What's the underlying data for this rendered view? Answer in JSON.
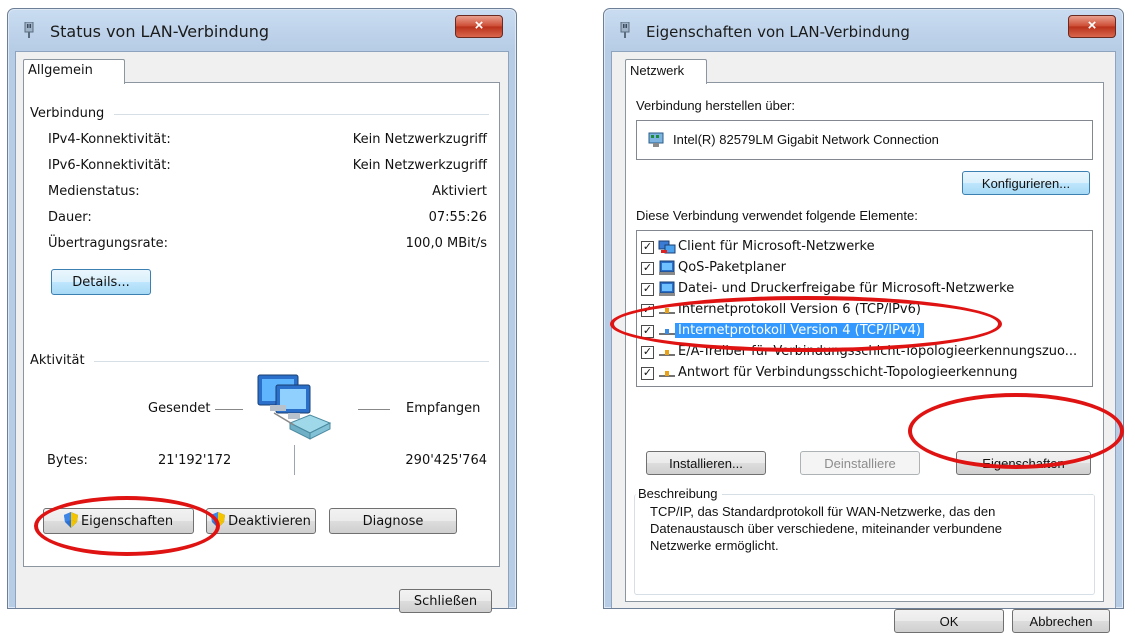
{
  "status_window": {
    "title": "Status von LAN-Verbindung",
    "close_label": "×",
    "tab": "Allgemein",
    "connection_group": "Verbindung",
    "rows": [
      {
        "label": "IPv4-Konnektivität:",
        "value": "Kein Netzwerkzugriff"
      },
      {
        "label": "IPv6-Konnektivität:",
        "value": "Kein Netzwerkzugriff"
      },
      {
        "label": "Medienstatus:",
        "value": "Aktiviert"
      },
      {
        "label": "Dauer:",
        "value": "07:55:26"
      },
      {
        "label": "Übertragungsrate:",
        "value": "100,0 MBit/s"
      }
    ],
    "details_button": "Details...",
    "activity_group": "Aktivität",
    "sent_label": "Gesendet",
    "received_label": "Empfangen",
    "bytes_label": "Bytes:",
    "bytes_sent": "21'192'172",
    "bytes_received": "290'425'764",
    "properties_button": "Eigenschaften",
    "disable_button": "Deaktivieren",
    "diagnose_button": "Diagnose",
    "close_button": "Schließen"
  },
  "properties_window": {
    "title": "Eigenschaften von LAN-Verbindung",
    "close_label": "×",
    "tab": "Netzwerk",
    "connect_using_label": "Verbindung herstellen über:",
    "adapter_name": "Intel(R) 82579LM Gigabit Network Connection",
    "configure_button": "Konfigurieren...",
    "items_label": "Diese Verbindung verwendet folgende Elemente:",
    "items": [
      {
        "label": "Client für Microsoft-Netzwerke",
        "checked": true,
        "icon": "network-client-icon"
      },
      {
        "label": "QoS-Paketplaner",
        "checked": true,
        "icon": "network-service-icon"
      },
      {
        "label": "Datei- und Druckerfreigabe für Microsoft-Netzwerke",
        "checked": true,
        "icon": "network-service-icon"
      },
      {
        "label": "Internetprotokoll Version 6 (TCP/IPv6)",
        "checked": true,
        "icon": "protocol-icon"
      },
      {
        "label": "Internetprotokoll Version 4 (TCP/IPv4)",
        "checked": true,
        "icon": "protocol-icon",
        "selected": true
      },
      {
        "label": "E/A-Treiber für Verbindungsschicht-Topologieerkennungszuo...",
        "checked": true,
        "icon": "protocol-icon"
      },
      {
        "label": "Antwort für Verbindungsschicht-Topologieerkennung",
        "checked": true,
        "icon": "protocol-icon"
      }
    ],
    "install_button": "Installieren...",
    "uninstall_button": "Deinstalliere",
    "properties_button": "Eigenschaften",
    "description_group": "Beschreibung",
    "description_text": "TCP/IP, das Standardprotokoll für WAN-Netzwerke, das den Datenaustausch über verschiedene, miteinander verbundene Netzwerke ermöglicht.",
    "ok_button": "OK",
    "cancel_button": "Abbrechen"
  },
  "colors": {
    "highlight_oval": "#e01313",
    "selection": "#3399ff"
  }
}
